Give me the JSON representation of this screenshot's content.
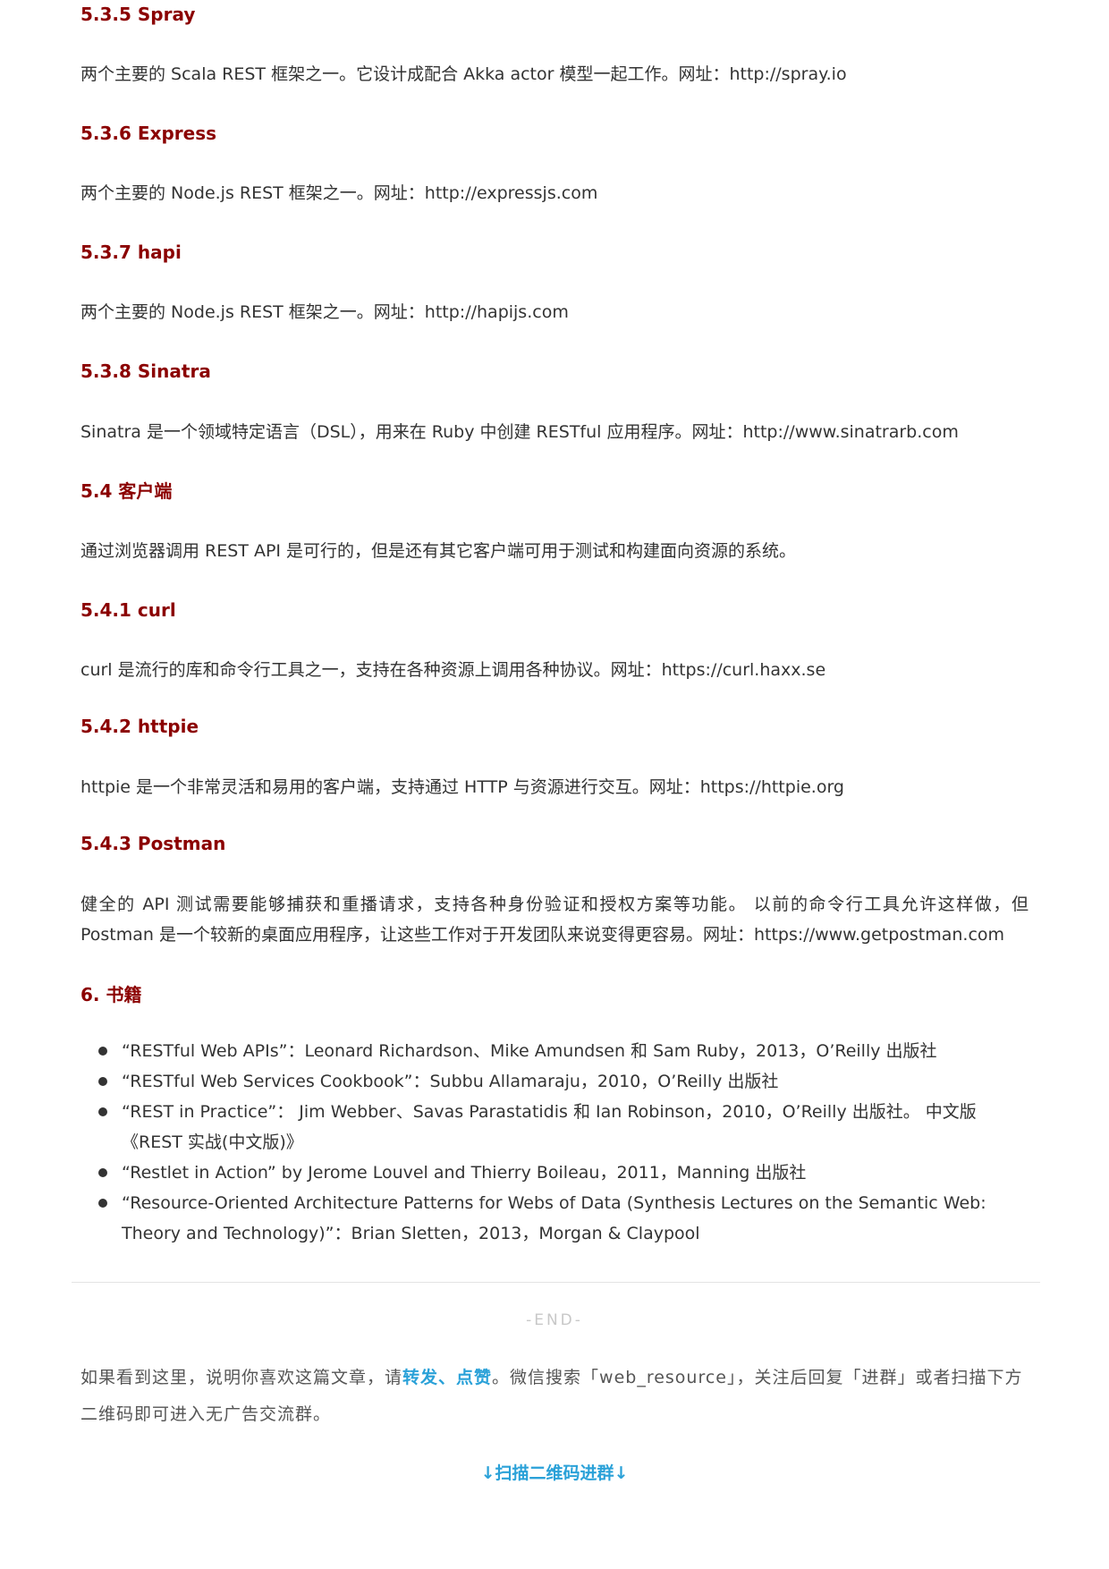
{
  "sections": {
    "s535": {
      "title": "5.3.5 Spray",
      "text": "两个主要的 Scala REST 框架之一。它设计成配合 Akka actor 模型一起工作。网址：http://spray.io"
    },
    "s536": {
      "title": "5.3.6 Express",
      "text": "两个主要的 Node.js REST 框架之一。网址：http://expressjs.com"
    },
    "s537": {
      "title": "5.3.7 hapi",
      "text": "两个主要的 Node.js REST 框架之一。网址：http://hapijs.com"
    },
    "s538": {
      "title": "5.3.8 Sinatra",
      "text": "Sinatra 是一个领域特定语言（DSL），用来在 Ruby 中创建 RESTful 应用程序。网址：http://www.sinatrarb.com"
    },
    "s54": {
      "title": "5.4 客户端",
      "text": "通过浏览器调用 REST API 是可行的，但是还有其它客户端可用于测试和构建面向资源的系统。"
    },
    "s541": {
      "title": "5.4.1 curl",
      "text": "curl 是流行的库和命令行工具之一，支持在各种资源上调用各种协议。网址：https://curl.haxx.se"
    },
    "s542": {
      "title": "5.4.2 httpie",
      "text": "httpie 是一个非常灵活和易用的客户端，支持通过 HTTP 与资源进行交互。网址：https://httpie.org"
    },
    "s543": {
      "title": "5.4.3 Postman",
      "text": "健全的 API 测试需要能够捕获和重播请求，支持各种身份验证和授权方案等功能。 以前的命令行工具允许这样做，但 Postman 是一个较新的桌面应用程序，让这些工作对于开发团队来说变得更容易。网址：https://www.getpostman.com"
    },
    "s6": {
      "title": "6. 书籍"
    }
  },
  "books": [
    "“RESTful Web APIs”：Leonard Richardson、Mike Amundsen 和 Sam Ruby，2013，O’Reilly 出版社",
    "“RESTful Web Services Cookbook”：Subbu Allamaraju，2010，O’Reilly 出版社",
    "“REST in Practice”： Jim Webber、Savas Parastatidis 和 Ian Robinson，2010，O’Reilly 出版社。 中文版《REST 实战(中文版)》",
    "“Restlet in Action” by Jerome Louvel and Thierry Boileau，2011，Manning 出版社",
    "“Resource-Oriented Architecture Patterns for Webs of Data (Synthesis Lectures on the Semantic Web: Theory and Technology)”：Brian Sletten，2013，Morgan & Claypool"
  ],
  "footer": {
    "end": "-END-",
    "follow_prefix": "如果看到这里，说明你喜欢这篇文章，请",
    "follow_highlight": "转发、点赞",
    "follow_suffix": "。微信搜索「web_resource」，关注后回复「进群」或者扫描下方二维码即可进入无广告交流群。",
    "qr_hint": "↓扫描二维码进群↓"
  }
}
